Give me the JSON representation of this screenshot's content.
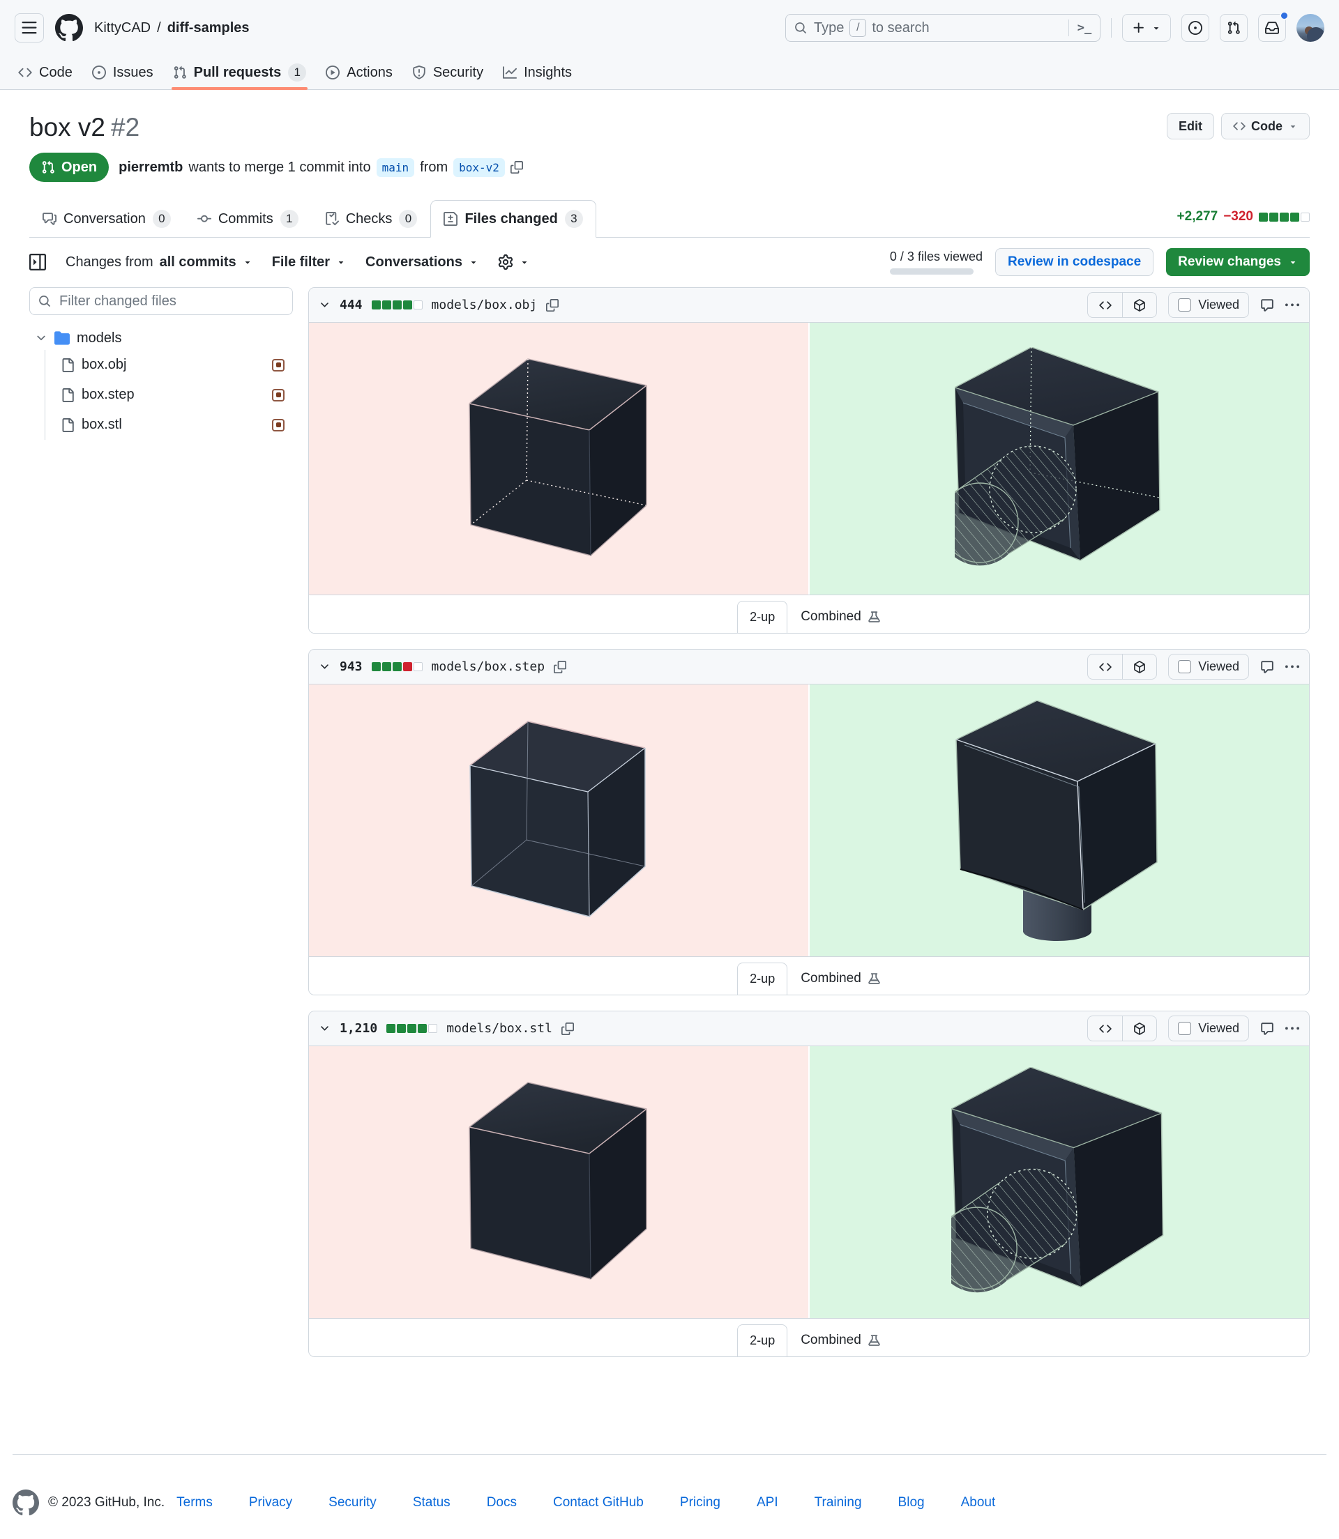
{
  "global_header": {
    "breadcrumb": {
      "org": "KittyCAD",
      "separator": "/",
      "repo": "diff-samples"
    },
    "search": {
      "prefix": "Type",
      "slash_key": "/",
      "suffix": "to search",
      "terminal_hint": ">_"
    }
  },
  "repo_nav": {
    "items": [
      {
        "label": "Code"
      },
      {
        "label": "Issues"
      },
      {
        "label": "Pull requests",
        "count": "1"
      },
      {
        "label": "Actions"
      },
      {
        "label": "Security"
      },
      {
        "label": "Insights"
      }
    ]
  },
  "pr": {
    "title": "box v2",
    "number": "#2",
    "state": "Open",
    "author": "pierremtb",
    "merge_text": "wants to merge 1 commit into",
    "base_branch": "main",
    "from_text": "from",
    "head_branch": "box-v2",
    "edit_button": "Edit",
    "code_button": "Code"
  },
  "pr_tabs": [
    {
      "label": "Conversation",
      "count": "0"
    },
    {
      "label": "Commits",
      "count": "1"
    },
    {
      "label": "Checks",
      "count": "0"
    },
    {
      "label": "Files changed",
      "count": "3"
    }
  ],
  "diffstat": {
    "additions": "+2,277",
    "deletions": "−320",
    "blocks": [
      "add",
      "add",
      "add",
      "add",
      "empty"
    ]
  },
  "diffbar": {
    "changes_from": "Changes from",
    "commit_range": "all commits",
    "file_filter": "File filter",
    "conversations": "Conversations",
    "viewed_status": "0 / 3 files viewed",
    "review_codespace": "Review in codespace",
    "review_changes": "Review changes"
  },
  "sidebar": {
    "filter_placeholder": "Filter changed files",
    "folder": "models",
    "files": [
      {
        "name": "box.obj"
      },
      {
        "name": "box.step"
      },
      {
        "name": "box.stl"
      }
    ]
  },
  "files": [
    {
      "lines_changed": "444",
      "path": "models/box.obj",
      "blocks": [
        "add",
        "add",
        "add",
        "add",
        "empty"
      ],
      "viewed_label": "Viewed",
      "two_up": "2-up",
      "combined": "Combined"
    },
    {
      "lines_changed": "943",
      "path": "models/box.step",
      "blocks": [
        "add",
        "add",
        "add",
        "del",
        "empty"
      ],
      "viewed_label": "Viewed",
      "two_up": "2-up",
      "combined": "Combined"
    },
    {
      "lines_changed": "1,210",
      "path": "models/box.stl",
      "blocks": [
        "add",
        "add",
        "add",
        "add",
        "empty"
      ],
      "viewed_label": "Viewed",
      "two_up": "2-up",
      "combined": "Combined"
    }
  ],
  "footer": {
    "copyright": "© 2023 GitHub, Inc.",
    "links": [
      "Terms",
      "Privacy",
      "Security",
      "Status",
      "Docs",
      "Contact GitHub",
      "Pricing",
      "API",
      "Training",
      "Blog",
      "About"
    ]
  }
}
